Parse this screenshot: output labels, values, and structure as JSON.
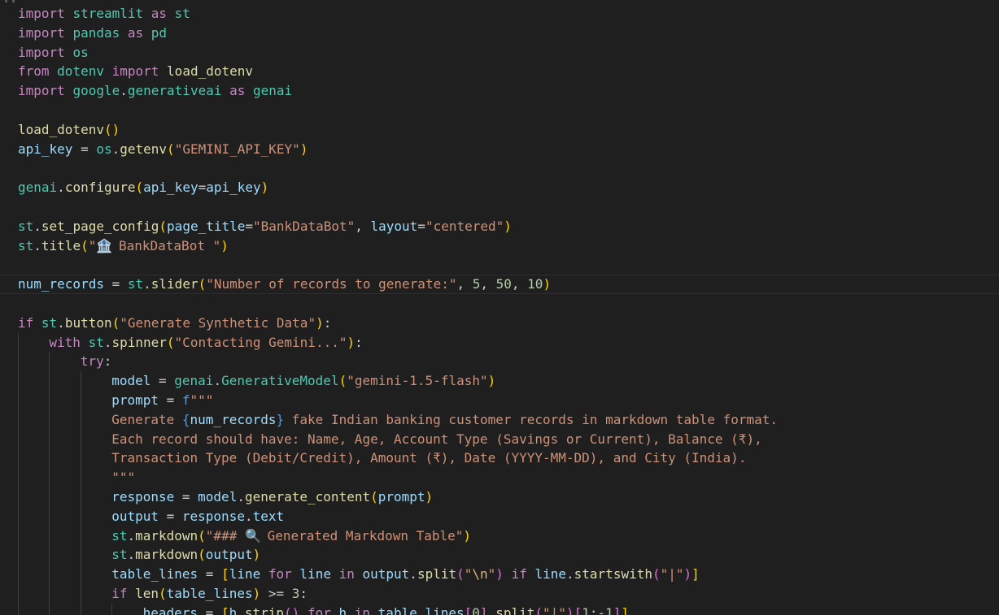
{
  "editor": {
    "colors": {
      "background": "#1f1f1f",
      "keyword": "#c586c0",
      "control": "#c586c0",
      "storage": "#569cd6",
      "variable": "#9cdcfe",
      "function": "#dcdcaa",
      "class": "#4ec9b0",
      "string": "#ce9178",
      "number": "#b5cea8",
      "punct": "#cccccc",
      "bracket1": "#ffd700",
      "bracket2": "#da70d6",
      "bracket3": "#179fff",
      "escape": "#d7ba7d",
      "interp": "#569cd6"
    },
    "lines": [
      {
        "indent": 0,
        "tokens": [
          [
            "import",
            "keyword"
          ],
          [
            " ",
            "punct"
          ],
          [
            "streamlit",
            "class"
          ],
          [
            " as ",
            "keyword"
          ],
          [
            "st",
            "class"
          ]
        ]
      },
      {
        "indent": 0,
        "tokens": [
          [
            "import",
            "keyword"
          ],
          [
            " ",
            "punct"
          ],
          [
            "pandas",
            "class"
          ],
          [
            " as ",
            "keyword"
          ],
          [
            "pd",
            "class"
          ]
        ]
      },
      {
        "indent": 0,
        "tokens": [
          [
            "import",
            "keyword"
          ],
          [
            " ",
            "punct"
          ],
          [
            "os",
            "class"
          ]
        ]
      },
      {
        "indent": 0,
        "tokens": [
          [
            "from",
            "keyword"
          ],
          [
            " ",
            "punct"
          ],
          [
            "dotenv",
            "class"
          ],
          [
            " ",
            "punct"
          ],
          [
            "import",
            "keyword"
          ],
          [
            " ",
            "punct"
          ],
          [
            "load_dotenv",
            "function"
          ]
        ]
      },
      {
        "indent": 0,
        "tokens": [
          [
            "import",
            "keyword"
          ],
          [
            " ",
            "punct"
          ],
          [
            "google",
            "class"
          ],
          [
            ".",
            "punct"
          ],
          [
            "generativeai",
            "class"
          ],
          [
            " as ",
            "keyword"
          ],
          [
            "genai",
            "class"
          ]
        ]
      },
      {
        "indent": 0,
        "tokens": []
      },
      {
        "indent": 0,
        "tokens": [
          [
            "load_dotenv",
            "function"
          ],
          [
            "()",
            "bracket1"
          ]
        ]
      },
      {
        "indent": 0,
        "tokens": [
          [
            "api_key",
            "variable"
          ],
          [
            " = ",
            "punct"
          ],
          [
            "os",
            "class"
          ],
          [
            ".",
            "punct"
          ],
          [
            "getenv",
            "function"
          ],
          [
            "(",
            "bracket1"
          ],
          [
            "\"GEMINI_API_KEY\"",
            "string"
          ],
          [
            ")",
            "bracket1"
          ]
        ]
      },
      {
        "indent": 0,
        "tokens": []
      },
      {
        "indent": 0,
        "tokens": [
          [
            "genai",
            "class"
          ],
          [
            ".",
            "punct"
          ],
          [
            "configure",
            "function"
          ],
          [
            "(",
            "bracket1"
          ],
          [
            "api_key",
            "variable"
          ],
          [
            "=",
            "punct"
          ],
          [
            "api_key",
            "variable"
          ],
          [
            ")",
            "bracket1"
          ]
        ]
      },
      {
        "indent": 0,
        "tokens": []
      },
      {
        "indent": 0,
        "tokens": [
          [
            "st",
            "class"
          ],
          [
            ".",
            "punct"
          ],
          [
            "set_page_config",
            "function"
          ],
          [
            "(",
            "bracket1"
          ],
          [
            "page_title",
            "variable"
          ],
          [
            "=",
            "punct"
          ],
          [
            "\"BankDataBot\"",
            "string"
          ],
          [
            ", ",
            "punct"
          ],
          [
            "layout",
            "variable"
          ],
          [
            "=",
            "punct"
          ],
          [
            "\"centered\"",
            "string"
          ],
          [
            ")",
            "bracket1"
          ]
        ]
      },
      {
        "indent": 0,
        "tokens": [
          [
            "st",
            "class"
          ],
          [
            ".",
            "punct"
          ],
          [
            "title",
            "function"
          ],
          [
            "(",
            "bracket1"
          ],
          [
            "\"",
            "string"
          ],
          [
            "bank-icon",
            "icon"
          ],
          [
            " BankDataBot \"",
            "string"
          ],
          [
            ")",
            "bracket1"
          ]
        ]
      },
      {
        "indent": 0,
        "tokens": []
      },
      {
        "indent": 0,
        "current": true,
        "tokens": [
          [
            "num_records",
            "variable"
          ],
          [
            " = ",
            "punct"
          ],
          [
            "st",
            "class"
          ],
          [
            ".",
            "punct"
          ],
          [
            "slider",
            "function"
          ],
          [
            "(",
            "bracket1"
          ],
          [
            "\"Number of records to generate:\"",
            "string"
          ],
          [
            ", ",
            "punct"
          ],
          [
            "5",
            "number"
          ],
          [
            ", ",
            "punct"
          ],
          [
            "50",
            "number"
          ],
          [
            ", ",
            "punct"
          ],
          [
            "10",
            "number"
          ],
          [
            ")",
            "bracket1"
          ]
        ]
      },
      {
        "indent": 0,
        "tokens": []
      },
      {
        "indent": 0,
        "tokens": [
          [
            "if",
            "control"
          ],
          [
            " ",
            "punct"
          ],
          [
            "st",
            "class"
          ],
          [
            ".",
            "punct"
          ],
          [
            "button",
            "function"
          ],
          [
            "(",
            "bracket1"
          ],
          [
            "\"Generate Synthetic Data\"",
            "string"
          ],
          [
            ")",
            "bracket1"
          ],
          [
            ":",
            "punct"
          ]
        ]
      },
      {
        "indent": 1,
        "tokens": [
          [
            "with",
            "control"
          ],
          [
            " ",
            "punct"
          ],
          [
            "st",
            "class"
          ],
          [
            ".",
            "punct"
          ],
          [
            "spinner",
            "function"
          ],
          [
            "(",
            "bracket1"
          ],
          [
            "\"Contacting Gemini...\"",
            "string"
          ],
          [
            ")",
            "bracket1"
          ],
          [
            ":",
            "punct"
          ]
        ]
      },
      {
        "indent": 2,
        "tokens": [
          [
            "try",
            "control"
          ],
          [
            ":",
            "punct"
          ]
        ]
      },
      {
        "indent": 3,
        "tokens": [
          [
            "model",
            "variable"
          ],
          [
            " = ",
            "punct"
          ],
          [
            "genai",
            "class"
          ],
          [
            ".",
            "punct"
          ],
          [
            "GenerativeModel",
            "class"
          ],
          [
            "(",
            "bracket1"
          ],
          [
            "\"gemini-1.5-flash\"",
            "string"
          ],
          [
            ")",
            "bracket1"
          ]
        ]
      },
      {
        "indent": 3,
        "tokens": [
          [
            "prompt",
            "variable"
          ],
          [
            " = ",
            "punct"
          ],
          [
            "f",
            "storage"
          ],
          [
            "\"\"\"",
            "string"
          ]
        ]
      },
      {
        "indent": 3,
        "tokens": [
          [
            "Generate ",
            "string"
          ],
          [
            "{",
            "interp"
          ],
          [
            "num_records",
            "variable"
          ],
          [
            "}",
            "interp"
          ],
          [
            " fake Indian banking customer records in markdown table format.",
            "string"
          ]
        ]
      },
      {
        "indent": 3,
        "tokens": [
          [
            "Each record should have: Name, Age, Account Type (Savings or Current), Balance (₹),",
            "string"
          ]
        ]
      },
      {
        "indent": 3,
        "tokens": [
          [
            "Transaction Type (Debit/Credit), Amount (₹), Date (YYYY-MM-DD), and City (India).",
            "string"
          ]
        ]
      },
      {
        "indent": 3,
        "tokens": [
          [
            "\"\"\"",
            "string"
          ]
        ]
      },
      {
        "indent": 3,
        "tokens": [
          [
            "response",
            "variable"
          ],
          [
            " = ",
            "punct"
          ],
          [
            "model",
            "variable"
          ],
          [
            ".",
            "punct"
          ],
          [
            "generate_content",
            "function"
          ],
          [
            "(",
            "bracket1"
          ],
          [
            "prompt",
            "variable"
          ],
          [
            ")",
            "bracket1"
          ]
        ]
      },
      {
        "indent": 3,
        "tokens": [
          [
            "output",
            "variable"
          ],
          [
            " = ",
            "punct"
          ],
          [
            "response",
            "variable"
          ],
          [
            ".",
            "punct"
          ],
          [
            "text",
            "variable"
          ]
        ]
      },
      {
        "indent": 3,
        "tokens": [
          [
            "st",
            "class"
          ],
          [
            ".",
            "punct"
          ],
          [
            "markdown",
            "function"
          ],
          [
            "(",
            "bracket1"
          ],
          [
            "\"### ",
            "string"
          ],
          [
            "magnifier-icon",
            "icon"
          ],
          [
            " Generated Markdown Table\"",
            "string"
          ],
          [
            ")",
            "bracket1"
          ]
        ]
      },
      {
        "indent": 3,
        "tokens": [
          [
            "st",
            "class"
          ],
          [
            ".",
            "punct"
          ],
          [
            "markdown",
            "function"
          ],
          [
            "(",
            "bracket1"
          ],
          [
            "output",
            "variable"
          ],
          [
            ")",
            "bracket1"
          ]
        ]
      },
      {
        "indent": 3,
        "tokens": [
          [
            "table_lines",
            "variable"
          ],
          [
            " = ",
            "punct"
          ],
          [
            "[",
            "bracket1"
          ],
          [
            "line",
            "variable"
          ],
          [
            " ",
            "punct"
          ],
          [
            "for",
            "control"
          ],
          [
            " ",
            "punct"
          ],
          [
            "line",
            "variable"
          ],
          [
            " ",
            "punct"
          ],
          [
            "in",
            "control"
          ],
          [
            " ",
            "punct"
          ],
          [
            "output",
            "variable"
          ],
          [
            ".",
            "punct"
          ],
          [
            "split",
            "function"
          ],
          [
            "(",
            "bracket2"
          ],
          [
            "\"",
            "string"
          ],
          [
            "\\n",
            "escape"
          ],
          [
            "\"",
            "string"
          ],
          [
            ")",
            "bracket2"
          ],
          [
            " ",
            "punct"
          ],
          [
            "if",
            "control"
          ],
          [
            " ",
            "punct"
          ],
          [
            "line",
            "variable"
          ],
          [
            ".",
            "punct"
          ],
          [
            "startswith",
            "function"
          ],
          [
            "(",
            "bracket2"
          ],
          [
            "\"|\"",
            "string"
          ],
          [
            ")",
            "bracket2"
          ],
          [
            "]",
            "bracket1"
          ]
        ]
      },
      {
        "indent": 3,
        "tokens": [
          [
            "if",
            "control"
          ],
          [
            " ",
            "punct"
          ],
          [
            "len",
            "function"
          ],
          [
            "(",
            "bracket1"
          ],
          [
            "table_lines",
            "variable"
          ],
          [
            ")",
            "bracket1"
          ],
          [
            " >= ",
            "punct"
          ],
          [
            "3",
            "number"
          ],
          [
            ":",
            "punct"
          ]
        ]
      },
      {
        "indent": 4,
        "tokens": [
          [
            "headers",
            "variable"
          ],
          [
            " = ",
            "punct"
          ],
          [
            "[",
            "bracket1"
          ],
          [
            "h",
            "variable"
          ],
          [
            ".",
            "punct"
          ],
          [
            "strip",
            "function"
          ],
          [
            "()",
            "bracket2"
          ],
          [
            " ",
            "punct"
          ],
          [
            "for",
            "control"
          ],
          [
            " ",
            "punct"
          ],
          [
            "h",
            "variable"
          ],
          [
            " ",
            "punct"
          ],
          [
            "in",
            "control"
          ],
          [
            " ",
            "punct"
          ],
          [
            "table_lines",
            "variable"
          ],
          [
            "[",
            "bracket2"
          ],
          [
            "0",
            "number"
          ],
          [
            "]",
            "bracket2"
          ],
          [
            ".",
            "punct"
          ],
          [
            "split",
            "function"
          ],
          [
            "(",
            "bracket2"
          ],
          [
            "\"|\"",
            "string"
          ],
          [
            ")",
            "bracket2"
          ],
          [
            "[",
            "bracket2"
          ],
          [
            "1",
            "number"
          ],
          [
            ":",
            "punct"
          ],
          [
            "-1",
            "number"
          ],
          [
            "]",
            "bracket2"
          ],
          [
            "]",
            "bracket1"
          ]
        ]
      }
    ]
  }
}
